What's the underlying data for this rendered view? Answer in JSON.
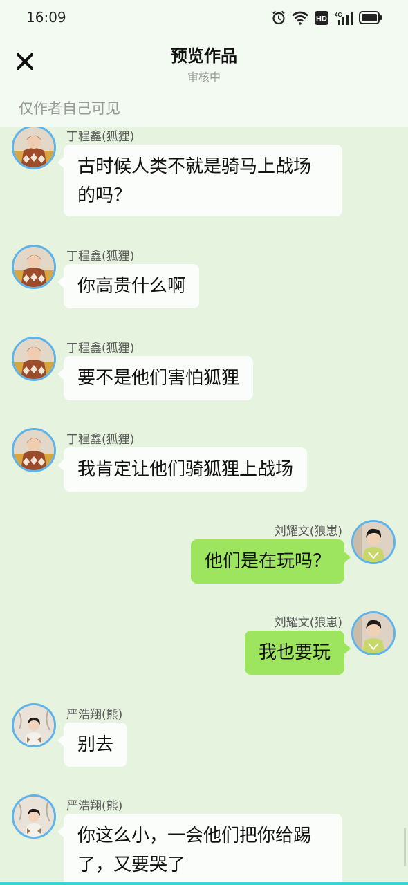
{
  "status_bar": {
    "time": "16:09",
    "icons": [
      "alarm-icon",
      "wifi-icon",
      "hd-icon",
      "4g-signal-icon",
      "battery-icon"
    ],
    "hd_label": "HD",
    "network_label": "4G"
  },
  "header": {
    "close_icon": "close-icon",
    "title": "预览作品",
    "subtitle": "审核中",
    "visibility_note": "仅作者自己可见"
  },
  "messages": [
    {
      "side": "left",
      "sender": "丁程鑫(狐狸)",
      "text": "古时候人类不就是骑马上战场的吗？",
      "avatar": "avatar-dingchengxin"
    },
    {
      "side": "left",
      "sender": "丁程鑫(狐狸)",
      "text": "你高贵什么啊",
      "avatar": "avatar-dingchengxin"
    },
    {
      "side": "left",
      "sender": "丁程鑫(狐狸)",
      "text": "要不是他们害怕狐狸",
      "avatar": "avatar-dingchengxin"
    },
    {
      "side": "left",
      "sender": "丁程鑫(狐狸)",
      "text": "我肯定让他们骑狐狸上战场",
      "avatar": "avatar-dingchengxin"
    },
    {
      "side": "right",
      "sender": "刘耀文(狼崽)",
      "text": "他们是在玩吗？",
      "avatar": "avatar-liuyaowen"
    },
    {
      "side": "right",
      "sender": "刘耀文(狼崽)",
      "text": "我也要玩",
      "avatar": "avatar-liuyaowen"
    },
    {
      "side": "left",
      "sender": "严浩翔(熊)",
      "text": "别去",
      "avatar": "avatar-yanhaoxiang"
    },
    {
      "side": "left",
      "sender": "严浩翔(熊)",
      "text": "你这么小，一会他们把你给踢了，又要哭了",
      "avatar": "avatar-yanhaoxiang"
    }
  ],
  "colors": {
    "chat_background": "#e5f3df",
    "header_background": "#f3faf1",
    "incoming_bubble": "#fbfdfa",
    "outgoing_bubble": "#9ee55f",
    "avatar_border": "#5db3ea",
    "bottom_strip": "#38d4d0"
  }
}
